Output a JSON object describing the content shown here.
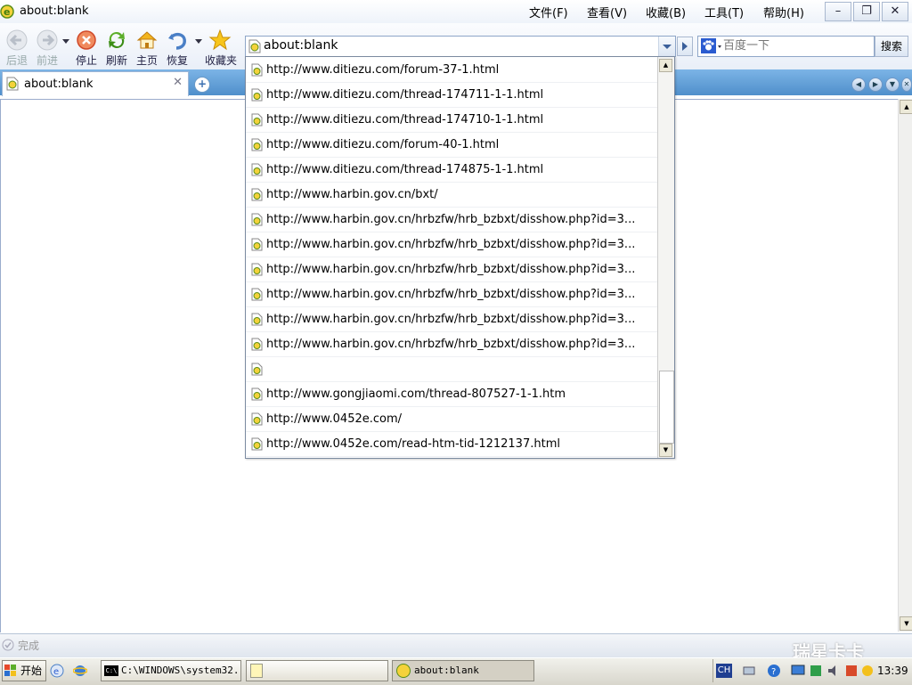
{
  "window": {
    "title": "about:blank"
  },
  "menu": [
    {
      "label": "文件(F)"
    },
    {
      "label": "查看(V)"
    },
    {
      "label": "收藏(B)"
    },
    {
      "label": "工具(T)"
    },
    {
      "label": "帮助(H)"
    }
  ],
  "window_controls": {
    "minimize": "–",
    "restore": "❐",
    "close": "✕"
  },
  "toolbar": {
    "back": "后退",
    "forward": "前进",
    "stop": "停止",
    "refresh": "刷新",
    "home": "主页",
    "restore": "恢复",
    "favorites": "收藏夹"
  },
  "address": {
    "value": "about:blank"
  },
  "search": {
    "placeholder": "百度一下",
    "button": "搜索"
  },
  "tab": {
    "title": "about:blank",
    "close": "✕",
    "new": "+"
  },
  "dropdown": {
    "items": [
      "http://www.ditiezu.com/forum-37-1.html",
      "http://www.ditiezu.com/thread-174711-1-1.html",
      "http://www.ditiezu.com/thread-174710-1-1.html",
      "http://www.ditiezu.com/forum-40-1.html",
      "http://www.ditiezu.com/thread-174875-1-1.html",
      "http://www.harbin.gov.cn/bxt/",
      "http://www.harbin.gov.cn/hrbzfw/hrb_bzbxt/disshow.php?id=3...",
      "http://www.harbin.gov.cn/hrbzfw/hrb_bzbxt/disshow.php?id=3...",
      "http://www.harbin.gov.cn/hrbzfw/hrb_bzbxt/disshow.php?id=3...",
      "http://www.harbin.gov.cn/hrbzfw/hrb_bzbxt/disshow.php?id=3...",
      "http://www.harbin.gov.cn/hrbzfw/hrb_bzbxt/disshow.php?id=3...",
      "http://www.harbin.gov.cn/hrbzfw/hrb_bzbxt/disshow.php?id=3...",
      "",
      "http://www.gongjiaomi.com/thread-807527-1-1.htm",
      "http://www.0452e.com/",
      "http://www.0452e.com/read-htm-tid-1212137.html"
    ]
  },
  "status": {
    "text": "完成"
  },
  "watermark": "瑞星卡卡",
  "taskbar": {
    "start": "开始",
    "tasks": [
      "C:\\WINDOWS\\system32...",
      "",
      "about:blank"
    ],
    "ime": "CH",
    "clock": "13:39"
  },
  "colors": {
    "accent": "#4f8fcb",
    "link_icon": "#6aa51f"
  }
}
